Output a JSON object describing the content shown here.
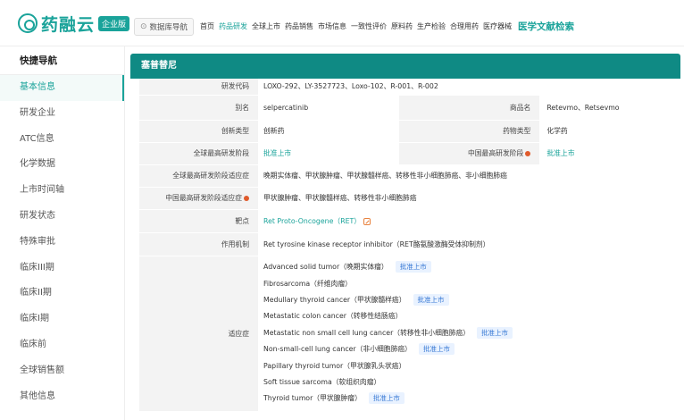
{
  "header": {
    "logo_text": "药融云",
    "logo_badge": "企业版",
    "db_nav_label": "数据库导航",
    "menu": [
      "首页",
      "药品研发",
      "全球上市",
      "药品销售",
      "市场信息",
      "一致性评价",
      "原料药",
      "生产检验",
      "合理用药",
      "医疗器械"
    ],
    "menu_active": "药品研发",
    "menu_highlight": "医学文献检索"
  },
  "sidebar": {
    "title": "快捷导航",
    "items": [
      {
        "label": "基本信息",
        "active": true
      },
      {
        "label": "研发企业"
      },
      {
        "label": "ATC信息"
      },
      {
        "label": "化学数据"
      },
      {
        "label": "上市时间轴"
      },
      {
        "label": "研发状态"
      },
      {
        "label": "特殊审批"
      },
      {
        "label": "临床III期"
      },
      {
        "label": "临床II期"
      },
      {
        "label": "临床I期"
      },
      {
        "label": "临床前"
      },
      {
        "label": "全球销售额"
      },
      {
        "label": "其他信息"
      }
    ]
  },
  "drug": {
    "title": "塞普替尼",
    "rows": {
      "code_label": "研发代码",
      "code_value": "LOXO-292、LY-3527723、Loxo-102、R-001、R-002",
      "alias_label": "别名",
      "alias_value": "selpercatinib",
      "brand_label": "商品名",
      "brand_value": "Retevmo、Retsevmo",
      "innov_label": "创新类型",
      "innov_value": "创新药",
      "drugtype_label": "药物类型",
      "drugtype_value": "化学药",
      "global_stage_label": "全球最高研发阶段",
      "global_stage_value": "批准上市",
      "china_stage_label": "中国最高研发阶段",
      "china_stage_value": "批准上市",
      "global_ind_label": "全球最高研发阶段适应症",
      "global_ind_value": "晚期实体瘤、甲状腺肿瘤、甲状腺髓样癌、转移性非小细胞肺癌、非小细胞肺癌",
      "china_ind_label": "中国最高研发阶段适应症",
      "china_ind_value": "甲状腺肿瘤、甲状腺髓样癌、转移性非小细胞肺癌",
      "target_label": "靶点",
      "target_value": "Ret Proto-Oncogene（RET）",
      "mech_label": "作用机制",
      "mech_value": "Ret tyrosine kinase receptor inhibitor（RET酪氨酸激酶受体抑制剂）",
      "indication_label": "适应症"
    },
    "indications": [
      {
        "text": "Advanced solid tumor（晚期实体瘤）",
        "tag": "批准上市"
      },
      {
        "text": "Fibrosarcoma（纤维肉瘤）",
        "tag": ""
      },
      {
        "text": "Medullary thyroid cancer（甲状腺髓样癌）",
        "tag": "批准上市"
      },
      {
        "text": "Metastatic colon cancer（转移性结肠癌）",
        "tag": ""
      },
      {
        "text": "Metastatic non small cell lung cancer（转移性非小细胞肺癌）",
        "tag": "批准上市"
      },
      {
        "text": "Non-small-cell lung cancer（非小细胞肺癌）",
        "tag": "批准上市"
      },
      {
        "text": "Papillary thyroid tumor（甲状腺乳头状癌）",
        "tag": ""
      },
      {
        "text": "Soft tissue sarcoma（软组织肉瘤）",
        "tag": ""
      },
      {
        "text": "Thyroid tumor（甲状腺肿瘤）",
        "tag": "批准上市"
      }
    ]
  },
  "colors": {
    "accent": "#1aa39a",
    "title_bar": "#0f8a84",
    "stage_dot": "#e05b2c",
    "tag_text": "#3a7bd5"
  }
}
